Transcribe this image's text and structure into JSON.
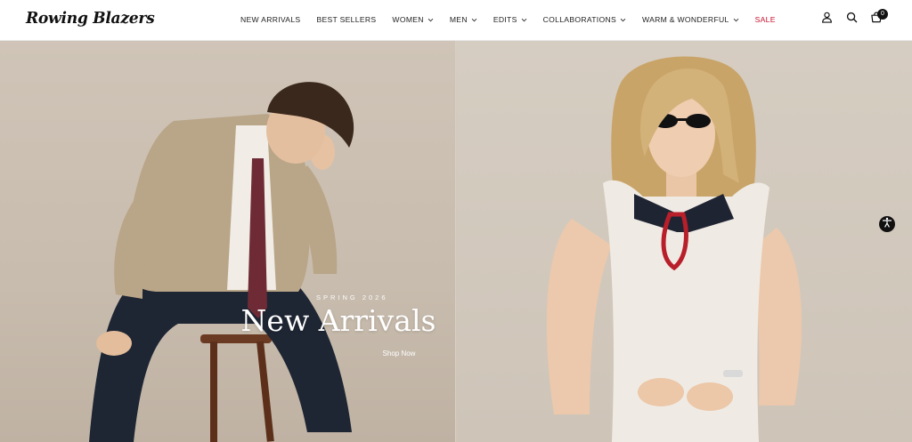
{
  "brand": {
    "logo_text": "Rowing Blazers"
  },
  "nav": {
    "items": [
      {
        "label": "NEW ARRIVALS",
        "dropdown": false
      },
      {
        "label": "BEST SELLERS",
        "dropdown": false
      },
      {
        "label": "WOMEN",
        "dropdown": true
      },
      {
        "label": "MEN",
        "dropdown": true
      },
      {
        "label": "EDITS",
        "dropdown": true
      },
      {
        "label": "COLLABORATIONS",
        "dropdown": true
      },
      {
        "label": "WARM & WONDERFUL",
        "dropdown": true
      },
      {
        "label": "SALE",
        "dropdown": false
      }
    ]
  },
  "header_icons": {
    "account": "user-icon",
    "search": "search-icon",
    "cart": "cart-icon",
    "cart_count": "0"
  },
  "hero": {
    "eyebrow": "SPRING 2026",
    "headline": "New Arrivals",
    "cta": "Shop Now"
  },
  "accessibility": {
    "icon": "accessibility-icon"
  },
  "colors": {
    "sale": "#c8102e",
    "left_panel": "#c8bcae",
    "right_panel": "#d3cabe"
  }
}
